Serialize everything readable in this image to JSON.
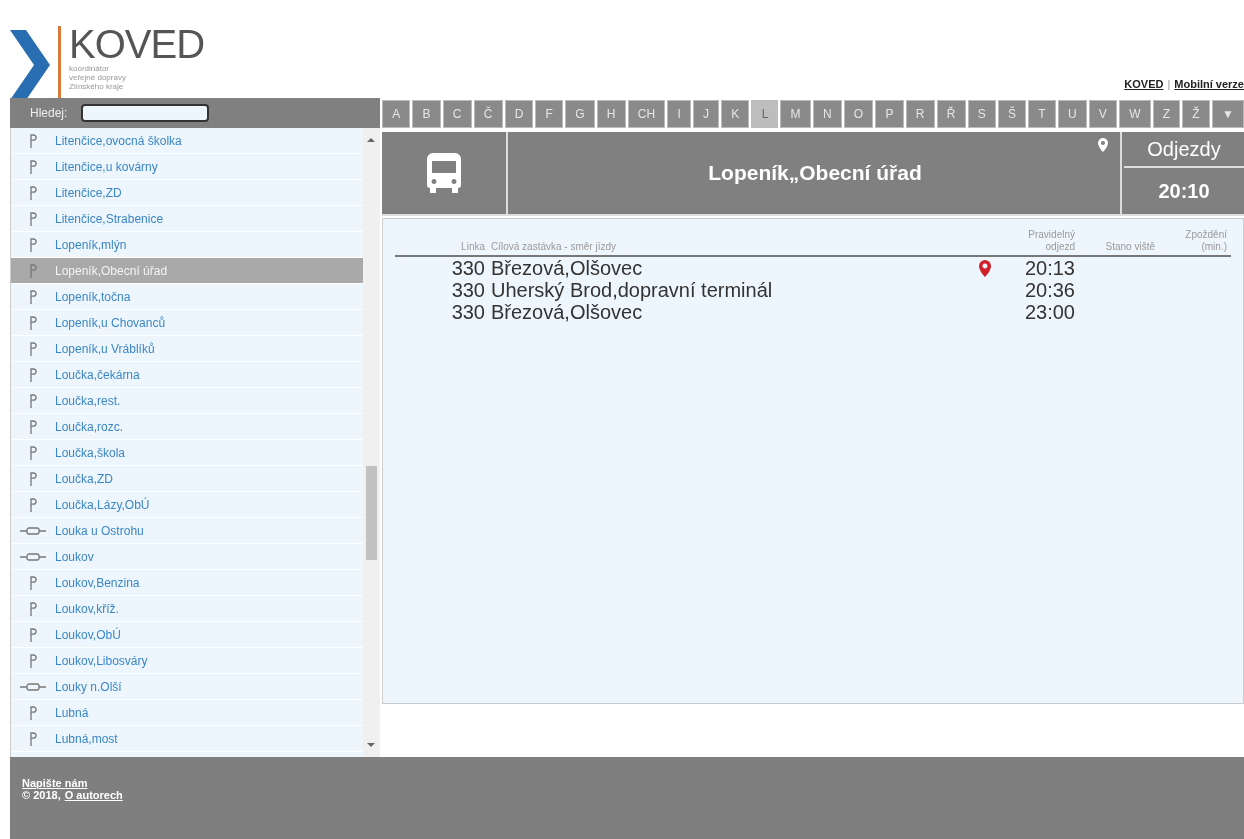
{
  "logo": {
    "name": "KOVED",
    "subtitle": [
      "koordinátor",
      "veřejné dopravy",
      "Zlínského kraje"
    ]
  },
  "top_links": [
    {
      "label": "KOVED"
    },
    {
      "label": "Mobilní verze"
    }
  ],
  "top_links_separator": "|",
  "search": {
    "label": "Hledej:"
  },
  "letters": [
    {
      "label": "A",
      "selected": false
    },
    {
      "label": "B",
      "selected": false
    },
    {
      "label": "C",
      "selected": false
    },
    {
      "label": "Č",
      "selected": false
    },
    {
      "label": "D",
      "selected": false
    },
    {
      "label": "F",
      "selected": false
    },
    {
      "label": "G",
      "selected": false
    },
    {
      "label": "H",
      "selected": false
    },
    {
      "label": "CH",
      "selected": false
    },
    {
      "label": "I",
      "selected": false
    },
    {
      "label": "J",
      "selected": false
    },
    {
      "label": "K",
      "selected": false
    },
    {
      "label": "L",
      "selected": true
    },
    {
      "label": "M",
      "selected": false
    },
    {
      "label": "N",
      "selected": false
    },
    {
      "label": "O",
      "selected": false
    },
    {
      "label": "P",
      "selected": false
    },
    {
      "label": "R",
      "selected": false
    },
    {
      "label": "Ř",
      "selected": false
    },
    {
      "label": "S",
      "selected": false
    },
    {
      "label": "Š",
      "selected": false
    },
    {
      "label": "T",
      "selected": false
    },
    {
      "label": "U",
      "selected": false
    },
    {
      "label": "V",
      "selected": false
    },
    {
      "label": "W",
      "selected": false
    },
    {
      "label": "Z",
      "selected": false
    },
    {
      "label": "Ž",
      "selected": false
    },
    {
      "label": "▼",
      "selected": false
    }
  ],
  "stops": [
    {
      "name": "Litenčice,ovocná školka",
      "kind": "bus",
      "selected": false
    },
    {
      "name": "Litenčice,u kovárny",
      "kind": "bus",
      "selected": false
    },
    {
      "name": "Litenčice,ZD",
      "kind": "bus",
      "selected": false
    },
    {
      "name": "Litenčice,Strabenice",
      "kind": "bus",
      "selected": false
    },
    {
      "name": "Lopeník,mlýn",
      "kind": "bus",
      "selected": false
    },
    {
      "name": "Lopeník,Obecní úřad",
      "kind": "bus",
      "selected": true
    },
    {
      "name": "Lopeník,točna",
      "kind": "bus",
      "selected": false
    },
    {
      "name": "Lopeník,u Chovanců",
      "kind": "bus",
      "selected": false
    },
    {
      "name": "Lopeník,u Vráblíků",
      "kind": "bus",
      "selected": false
    },
    {
      "name": "Loučka,čekárna",
      "kind": "bus",
      "selected": false
    },
    {
      "name": "Loučka,rest.",
      "kind": "bus",
      "selected": false
    },
    {
      "name": "Loučka,rozc.",
      "kind": "bus",
      "selected": false
    },
    {
      "name": "Loučka,škola",
      "kind": "bus",
      "selected": false
    },
    {
      "name": "Loučka,ZD",
      "kind": "bus",
      "selected": false
    },
    {
      "name": "Loučka,Lázy,ObÚ",
      "kind": "bus",
      "selected": false
    },
    {
      "name": "Louka u Ostrohu",
      "kind": "rail",
      "selected": false
    },
    {
      "name": "Loukov",
      "kind": "rail",
      "selected": false
    },
    {
      "name": "Loukov,Benzina",
      "kind": "bus",
      "selected": false
    },
    {
      "name": "Loukov,kříž.",
      "kind": "bus",
      "selected": false
    },
    {
      "name": "Loukov,ObÚ",
      "kind": "bus",
      "selected": false
    },
    {
      "name": "Loukov,Libosváry",
      "kind": "bus",
      "selected": false
    },
    {
      "name": "Louky n.Olší",
      "kind": "rail",
      "selected": false
    },
    {
      "name": "Lubná",
      "kind": "bus",
      "selected": false
    },
    {
      "name": "Lubná,most",
      "kind": "bus",
      "selected": false
    }
  ],
  "station": {
    "kind": "bus",
    "name": "Lopeník„Obecní úřad",
    "mode": "Odjezdy",
    "time": "20:10"
  },
  "departures": {
    "columns": [
      "Linka",
      "Cílová zastávka - směr jízdy",
      "Pravidelný odjezd",
      "Stano viště",
      "Zpoždění (min.)"
    ],
    "rows": [
      {
        "line": "330",
        "destination": "Březová,Olšovec",
        "pin": true,
        "time": "20:13"
      },
      {
        "line": "330",
        "destination": "Uherský Brod,dopravní terminál",
        "pin": false,
        "time": "20:36"
      },
      {
        "line": "330",
        "destination": "Březová,Olšovec",
        "pin": false,
        "time": "23:00"
      }
    ]
  },
  "footer": {
    "contact": "Napište nám",
    "copyright": "© 2018,",
    "about": "O autorech"
  }
}
